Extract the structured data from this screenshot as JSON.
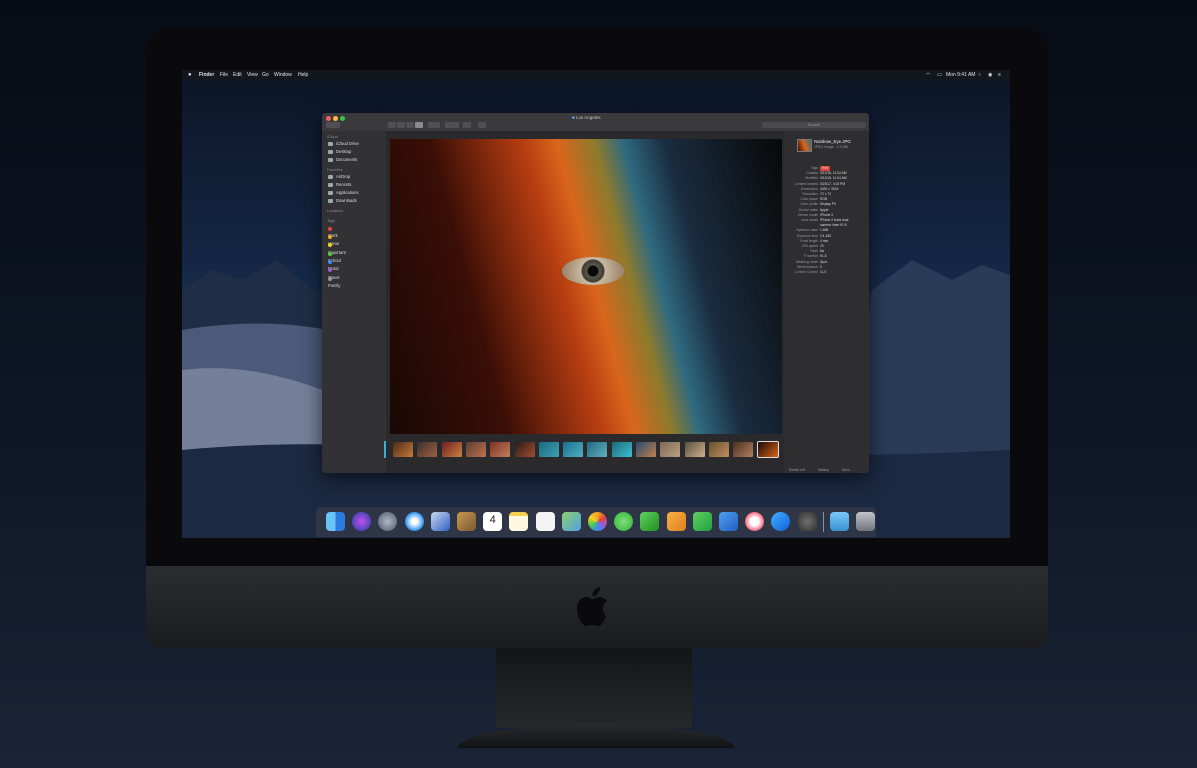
{
  "menubar": {
    "apple": "",
    "items": [
      "Finder",
      "File",
      "Edit",
      "View",
      "Go",
      "Window",
      "Help"
    ],
    "clock": "Mon 9:41 AM"
  },
  "window": {
    "title": "Los Angeles",
    "search_placeholder": "Search"
  },
  "sidebar": {
    "icloud_header": "iCloud",
    "icloud": [
      "iCloud Drive",
      "Desktop",
      "Documents"
    ],
    "favorites_header": "Favorites",
    "favorites": [
      "AirDrop",
      "Recents",
      "Applications",
      "Downloads"
    ],
    "locations_header": "Locations",
    "tags_header": "Tags",
    "tags": [
      {
        "label": "Work",
        "color": "#e0443e"
      },
      {
        "label": "Home",
        "color": "#f5a623"
      },
      {
        "label": "Important",
        "color": "#f5d023"
      },
      {
        "label": "School",
        "color": "#52c84a"
      },
      {
        "label": "Music",
        "color": "#3a8ef6"
      },
      {
        "label": "Travel",
        "color": "#9b59d6"
      },
      {
        "label": "Family",
        "color": "#9a9a9e"
      }
    ]
  },
  "inspector": {
    "filename": "Rainbow_Eye.JPG",
    "filetype": "JPEG image - 2.6 MB",
    "rows": [
      {
        "k": "Tags",
        "v": "Red"
      },
      {
        "k": "Created",
        "v": "3/12/16, 11:04 AM"
      },
      {
        "k": "Modified",
        "v": "3/12/16, 11:04 AM"
      },
      {
        "k": "Content created",
        "v": "3/23/17, 4:03 PM"
      },
      {
        "k": "Dimensions",
        "v": "4032 × 3024"
      },
      {
        "k": "Resolution",
        "v": "72 × 72"
      },
      {
        "k": "Color space",
        "v": "RGB"
      },
      {
        "k": "Color profile",
        "v": "Display P3"
      },
      {
        "k": "Device make",
        "v": "Apple"
      },
      {
        "k": "Device model",
        "v": "iPhone X"
      },
      {
        "k": "Lens model",
        "v": "iPhone X back dual"
      },
      {
        "k": "",
        "v": "camera 4mm f/1.8"
      },
      {
        "k": "Aperture value",
        "v": "1.695"
      },
      {
        "k": "Exposure time",
        "v": "1/1,183"
      },
      {
        "k": "Focal length",
        "v": "4 mm"
      },
      {
        "k": "ISO speed",
        "v": "20"
      },
      {
        "k": "Flash",
        "v": "No"
      },
      {
        "k": "F number",
        "v": "f/1.8"
      },
      {
        "k": "Metering mode",
        "v": "Spot"
      },
      {
        "k": "White balance",
        "v": "0"
      },
      {
        "k": "Content Creator",
        "v": "11.0"
      }
    ],
    "actions": [
      "Rotate Left",
      "Markup",
      "More..."
    ]
  },
  "dock": {
    "apps": [
      "finder-icon",
      "siri-icon",
      "launchpad-icon",
      "safari-icon",
      "mail-icon",
      "contacts-icon",
      "calendar-icon",
      "notes-icon",
      "reminders-icon",
      "maps-icon",
      "photos-icon",
      "messages-icon",
      "facetime-icon",
      "pages-icon",
      "numbers-icon",
      "keynote-icon",
      "music-icon",
      "app-store-icon",
      "system-preferences-icon",
      "downloads-folder-icon",
      "trash-icon"
    ],
    "calendar_day": "4"
  }
}
